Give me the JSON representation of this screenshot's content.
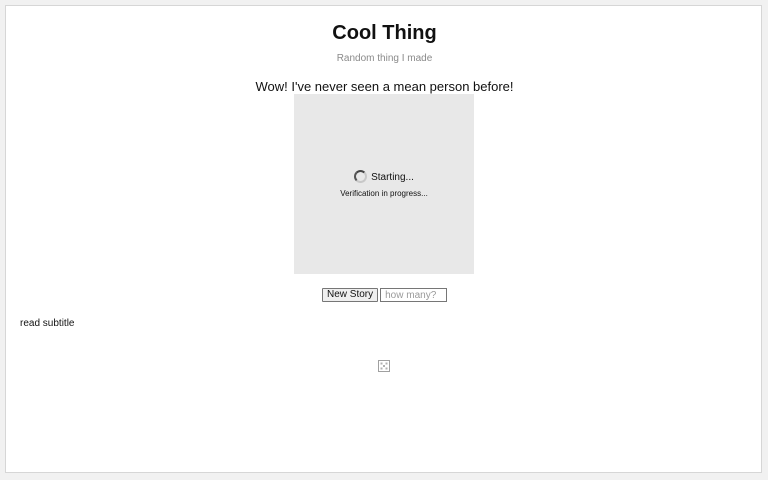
{
  "header": {
    "title": "Cool Thing",
    "subtitle": "Random thing I made"
  },
  "story": {
    "headline": "Wow! I've never seen a mean person before!"
  },
  "verification": {
    "status": "Starting...",
    "message": "Verification in progress..."
  },
  "controls": {
    "new_story_label": "New Story",
    "count_placeholder": "how many?",
    "count_value": ""
  },
  "footer": {
    "read_subtitle": "read subtitle"
  },
  "icons": {
    "spinner": "loading-spinner-icon",
    "broken_image": "broken-image-icon"
  },
  "colors": {
    "panel_background": "#e8e8e8",
    "subtitle_text": "#8a8a8a"
  }
}
